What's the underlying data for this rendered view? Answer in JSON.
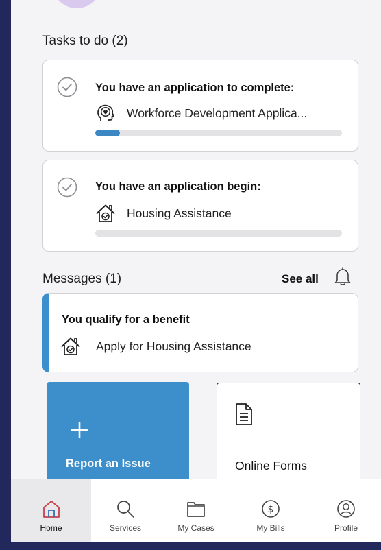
{
  "tasks": {
    "heading": "Tasks to do (2)",
    "items": [
      {
        "title": "You have an application to complete:",
        "name": "Workforce Development Applica...",
        "icon": "head-heart-icon",
        "progress": 0.1
      },
      {
        "title": "You have an application begin:",
        "name": "Housing Assistance",
        "icon": "house-check-icon",
        "progress": 0
      }
    ]
  },
  "messages": {
    "heading": "Messages (1)",
    "see_all": "See all",
    "item": {
      "title": "You qualify for a benefit",
      "text": "Apply for Housing Assistance",
      "icon": "house-check-icon"
    }
  },
  "tiles": {
    "report": {
      "label": "Report an Issue",
      "icon": "plus-icon"
    },
    "forms": {
      "label": "Online Forms",
      "icon": "document-icon"
    }
  },
  "nav": [
    {
      "label": "Home",
      "icon": "home-icon",
      "active": true
    },
    {
      "label": "Services",
      "icon": "search-icon"
    },
    {
      "label": "My Cases",
      "icon": "folder-icon"
    },
    {
      "label": "My Bills",
      "icon": "dollar-icon"
    },
    {
      "label": "Profile",
      "icon": "user-icon"
    }
  ],
  "colors": {
    "accent": "#3a8fcc",
    "tile_blue": "#3d8fcb",
    "background": "#23285c"
  }
}
